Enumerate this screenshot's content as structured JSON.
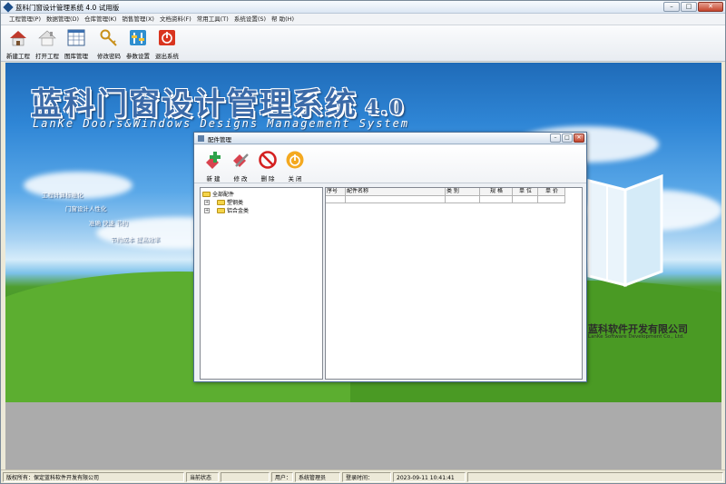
{
  "window": {
    "title": "蓝科门窗设计管理系统 4.0 试用版",
    "min_icon": "minimize-icon",
    "max_icon": "maximize-icon",
    "close_icon": "close-icon"
  },
  "menu": [
    "工程管理(P)",
    "数据管理(D)",
    "仓库管理(K)",
    "销售管理(X)",
    "文档资料(F)",
    "常用工具(T)",
    "系统设置(S)",
    "帮 助(H)"
  ],
  "toolbar": {
    "new_project": "新建工程",
    "open_project": "打开工程",
    "library": "图库管理",
    "change_password": "修改密码",
    "parameters": "参数设置",
    "exit": "退出系统"
  },
  "desktop": {
    "brand_cn": "蓝科门窗设计管理系统",
    "brand_version": "4.0",
    "brand_en": "LanKe Doors&Windows Designs Management System",
    "slogans": [
      "工程计算标准化",
      "门窗设计人性化",
      "准确  快速  节约",
      "节约成本  提高效率"
    ],
    "company_cn": "蓝科软件开发有限公司",
    "company_en": "LanKe Software Development Co., Ltd."
  },
  "dialog": {
    "title": "配件管理",
    "buttons": {
      "new": "新 建",
      "edit": "修 改",
      "delete": "删 除",
      "close": "关 闭"
    },
    "tree": {
      "root": "全部配件",
      "children": [
        "塑钢类",
        "铝合金类"
      ]
    },
    "grid": {
      "columns": [
        "序号",
        "配件名称",
        "类 别",
        "规 格",
        "单 位",
        "单 价"
      ]
    }
  },
  "status": {
    "copyright_label": "版权所有：",
    "copyright_value": "保定蓝科软件开发有限公司",
    "state_label": "当前状态",
    "state_value": "",
    "user_label": "用户：",
    "user_value": "系统管理员",
    "login_label": "登录时间：",
    "login_value": "2023-09-11  10:41:41"
  },
  "colors": {
    "brand_blue": "#3b6aa8",
    "delete_red": "#d42020",
    "close_orange": "#f4a920"
  }
}
